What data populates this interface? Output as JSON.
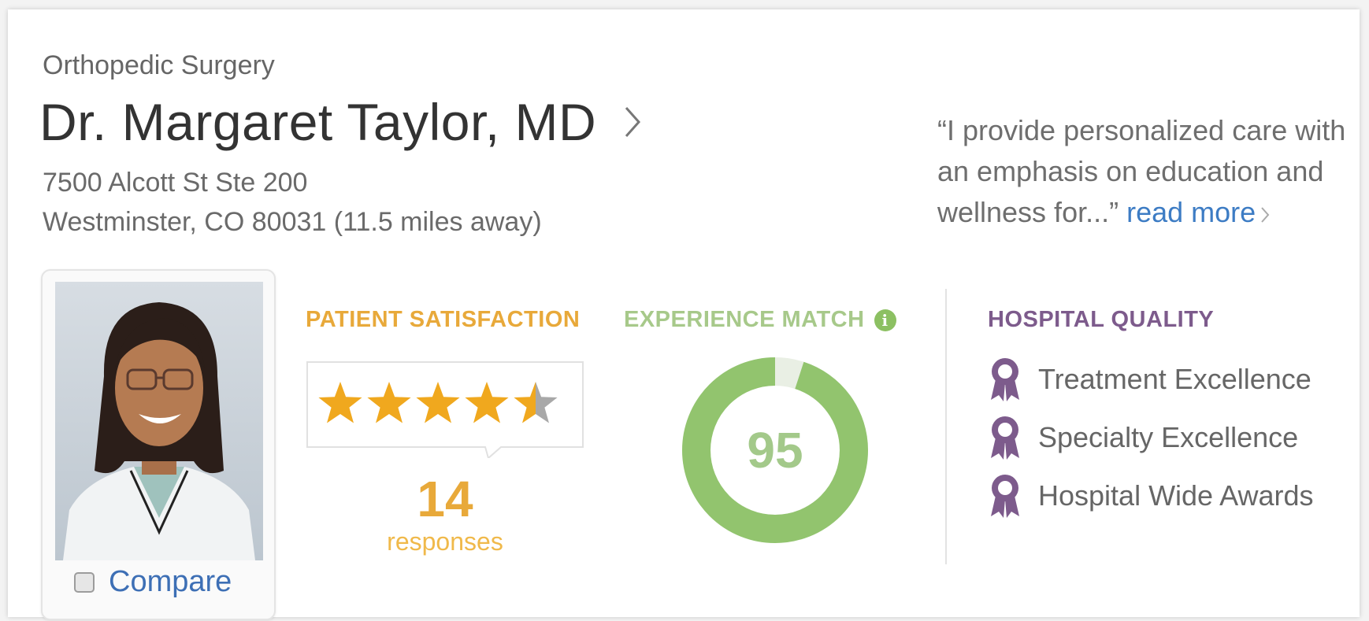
{
  "doctor": {
    "specialty": "Orthopedic Surgery",
    "name": "Dr. Margaret Taylor, MD",
    "address_line1": "7500 Alcott St Ste 200",
    "address_line2": "Westminster, CO 80031 (11.5 miles away)"
  },
  "quote": {
    "text": "“I provide personalized care with an emphasis on education and wellness for...” ",
    "read_more": "read more"
  },
  "compare": {
    "label": "Compare",
    "checked": false
  },
  "patient_satisfaction": {
    "title": "PATIENT SATISFACTION",
    "rating": 4.5,
    "max_rating": 5,
    "responses_count": "14",
    "responses_label": "responses"
  },
  "experience_match": {
    "title": "EXPERIENCE MATCH",
    "score": "95",
    "score_fraction": 0.95
  },
  "hospital_quality": {
    "title": "HOSPITAL QUALITY",
    "awards": [
      "Treatment Excellence",
      "Specialty Excellence",
      "Hospital Wide Awards"
    ]
  },
  "colors": {
    "star_gold": "#f0a81e",
    "star_empty": "#a8a8a8",
    "ps_accent": "#e8a93a",
    "em_accent": "#8cc062",
    "hq_accent": "#7d5b8c",
    "link": "#3d7cc4"
  },
  "icons": {
    "chevron": "chevron-right-icon",
    "info": "info-icon",
    "award": "award-ribbon-icon",
    "star": "star-icon"
  }
}
